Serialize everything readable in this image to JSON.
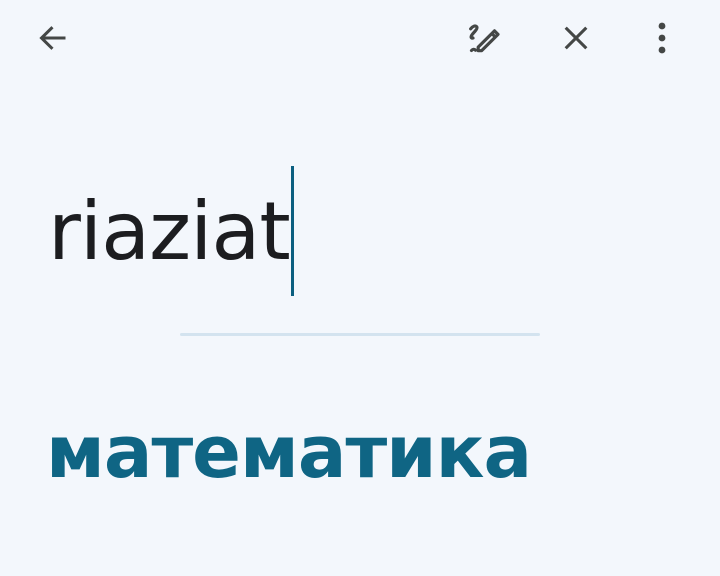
{
  "toolbar": {
    "back_icon": "arrow-left-icon",
    "handwriting_icon": "handwriting-pen-icon",
    "clear_icon": "close-icon",
    "more_icon": "more-vert-icon",
    "icon_color": "#444746"
  },
  "input": {
    "text": "riaziat",
    "text_color": "#1c1d20",
    "caret_color": "#0b5f80"
  },
  "result": {
    "text": "математика",
    "text_color": "#0f6584"
  },
  "colors": {
    "background": "#f3f7fc",
    "divider": "#d3e3ef"
  }
}
